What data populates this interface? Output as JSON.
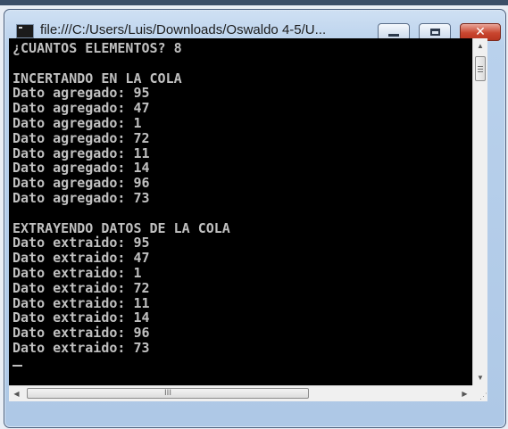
{
  "window": {
    "title": "file:///C:/Users/Luis/Downloads/Oswaldo 4-5/U...",
    "close_glyph": "✕",
    "accent_close": "#c9462f"
  },
  "console": {
    "lines": [
      "¿CUANTOS ELEMENTOS? 8",
      "",
      "INCERTANDO EN LA COLA",
      "Dato agregado: 95",
      "Dato agregado: 47",
      "Dato agregado: 1",
      "Dato agregado: 72",
      "Dato agregado: 11",
      "Dato agregado: 14",
      "Dato agregado: 96",
      "Dato agregado: 73",
      "",
      "EXTRAYENDO DATOS DE LA COLA",
      "Dato extraido: 95",
      "Dato extraido: 47",
      "Dato extraido: 1",
      "Dato extraido: 72",
      "Dato extraido: 11",
      "Dato extraido: 14",
      "Dato extraido: 96",
      "Dato extraido: 73"
    ],
    "text_color": "#c0c0c0",
    "background": "#000000"
  },
  "scrollbars": {
    "up_arrow": "▲",
    "down_arrow": "▼",
    "left_arrow": "◀",
    "right_arrow": "▶",
    "h_thumb_grip": "III",
    "size_grip": "⋰"
  }
}
